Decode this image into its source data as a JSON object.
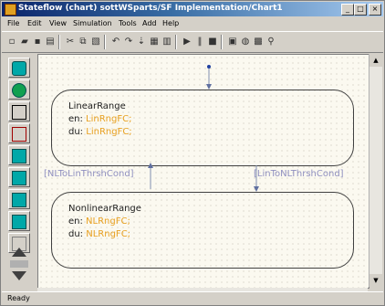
{
  "window": {
    "title": "Stateflow (chart) sottWSparts/SF Implementation/Chart1"
  },
  "menu": [
    "File",
    "Edit",
    "View",
    "Simulation",
    "Tools",
    "Add",
    "Help"
  ],
  "toolbar_icons": [
    "new-icon",
    "open-icon",
    "save-icon",
    "print-icon",
    "cut-icon",
    "copy-icon",
    "paste-icon",
    "undo-icon",
    "redo-icon",
    "parse-icon",
    "build-icon",
    "debug-icon",
    "play-icon",
    "pause-icon",
    "stop-icon",
    "explorer-icon",
    "find-icon",
    "library-icon",
    "zoom-icon"
  ],
  "palette_tools": [
    "state-tool",
    "history-junction-tool",
    "default-transition-tool",
    "connective-junction-tool",
    "truth-table-tool",
    "function-tool",
    "embedded-function-tool",
    "box-tool",
    "zoom-tool"
  ],
  "chart": {
    "states": [
      {
        "name": "LinearRange",
        "entry_label": "en:",
        "entry_action": "LinRngFC;",
        "during_label": "du:",
        "during_action": "LinRngFC;"
      },
      {
        "name": "NonlinearRange",
        "entry_label": "en:",
        "entry_action": "NLRngFC;",
        "during_label": "du:",
        "during_action": "NLRngFC;"
      }
    ],
    "transitions": [
      {
        "label": "[NLToLinThrshCond]"
      },
      {
        "label": "[LinToNLThrshCond]"
      }
    ]
  },
  "status": "Ready"
}
